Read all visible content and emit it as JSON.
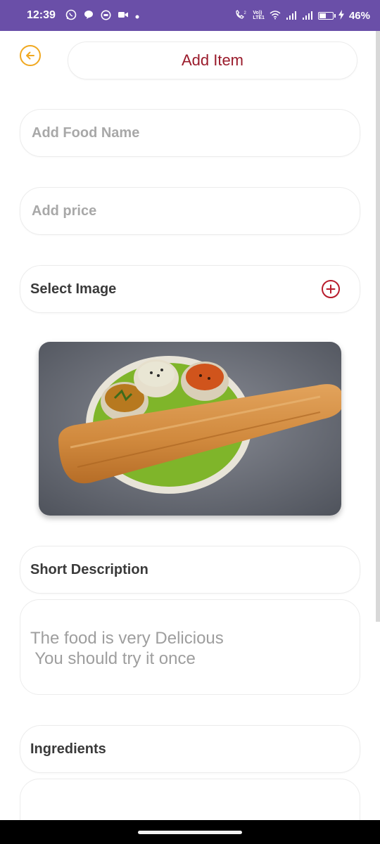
{
  "status_bar": {
    "time": "12:39",
    "battery": "46%",
    "battery_level": 0.46,
    "left_icons": [
      "whatsapp-icon",
      "chat-icon",
      "messenger-icon",
      "video-icon",
      "dot-icon"
    ],
    "right_icons": [
      "wifi-call-icon",
      "volte-icon",
      "wifi-icon",
      "signal-icon",
      "signal-icon",
      "battery-icon",
      "charging-icon"
    ],
    "volte_text": "Vo))\nLTE1",
    "call_sup": "2"
  },
  "header": {
    "title": "Add Item"
  },
  "form": {
    "food_name_placeholder": "Add Food Name",
    "price_placeholder": "Add price",
    "select_image_label": "Select Image",
    "short_description_label": "Short Description",
    "description_text": "The food is very Delicious\n You should try it once",
    "ingredients_label": "Ingredients"
  },
  "colors": {
    "status_bar": "#6a4fa8",
    "back_icon": "#f0a820",
    "title_text": "#9a1b2b",
    "add_icon": "#b81c2c"
  }
}
